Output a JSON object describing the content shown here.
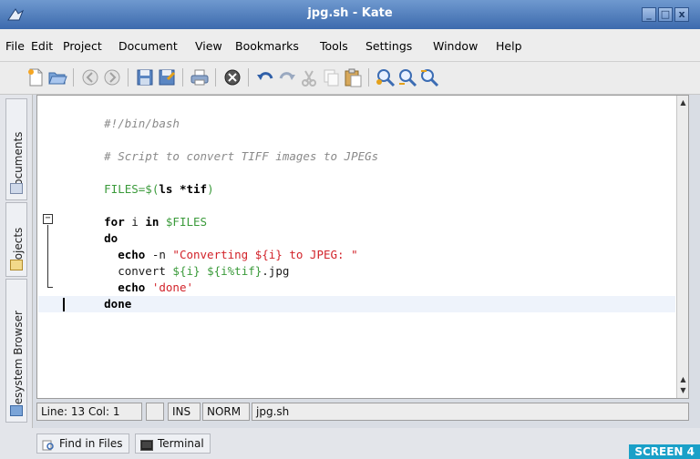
{
  "window": {
    "title": "jpg.sh - Kate",
    "min_label": "_",
    "max_label": "□",
    "close_label": "x"
  },
  "menu": [
    "File",
    "Edit",
    "Project",
    "Document",
    "View",
    "Bookmarks",
    "Tools",
    "Settings",
    "Window",
    "Help"
  ],
  "toolbar_icons": [
    "new-document-icon",
    "open-folder-icon",
    "back-icon",
    "forward-icon",
    "save-icon",
    "save-as-icon",
    "print-icon",
    "close-document-icon",
    "undo-icon",
    "redo-icon",
    "cut-icon",
    "copy-icon",
    "paste-icon",
    "find-icon",
    "find-next-icon",
    "find-previous-icon"
  ],
  "side_tabs": {
    "documents": "Documents",
    "projects": "Projects",
    "filesystem": "Filesystem Browser"
  },
  "code_lines": [
    "#!/bin/bash",
    "",
    "# Script to convert TIFF images to JPEGs",
    "",
    "FILES=$(ls *tif)",
    "",
    "for i in $FILES",
    "do",
    "  echo -n \"Converting ${i} to JPEG: \"",
    "  convert ${i} ${i%tif}.jpg",
    "  echo 'done'",
    "done",
    ""
  ],
  "code_segments": {
    "l0": "#!/bin/bash",
    "l2": "# Script to convert TIFF images to JPEGs",
    "l4a": "FILES=$(",
    "l4b": "ls *tif",
    "l4c": ")",
    "l6a": "for",
    "l6b": " i ",
    "l6c": "in",
    "l6d": " $FILES",
    "l7": "do",
    "l8a": "  echo",
    "l8b": " -n ",
    "l8c": "\"Converting ${i} to JPEG: \"",
    "l9a": "  convert ",
    "l9b": "${i}",
    "l9c": " ",
    "l9d": "${i%tif}",
    "l9e": ".jpg",
    "l10a": "  echo",
    "l10b": " ",
    "l10c": "'done'",
    "l11": "done"
  },
  "status": {
    "position": "Line: 13 Col: 1",
    "mode": "INS",
    "edit_mode": "NORM",
    "filename": "jpg.sh"
  },
  "bottom_tabs": {
    "find_in_files": "Find in Files",
    "terminal": "Terminal"
  },
  "screen_label": "SCREEN 4",
  "colors": {
    "titlebar": "#3c6aad",
    "comment": "#8a8a8a",
    "variable": "#3a9a3a",
    "string": "#d2232a",
    "label_badge": "#1aa0c8"
  }
}
